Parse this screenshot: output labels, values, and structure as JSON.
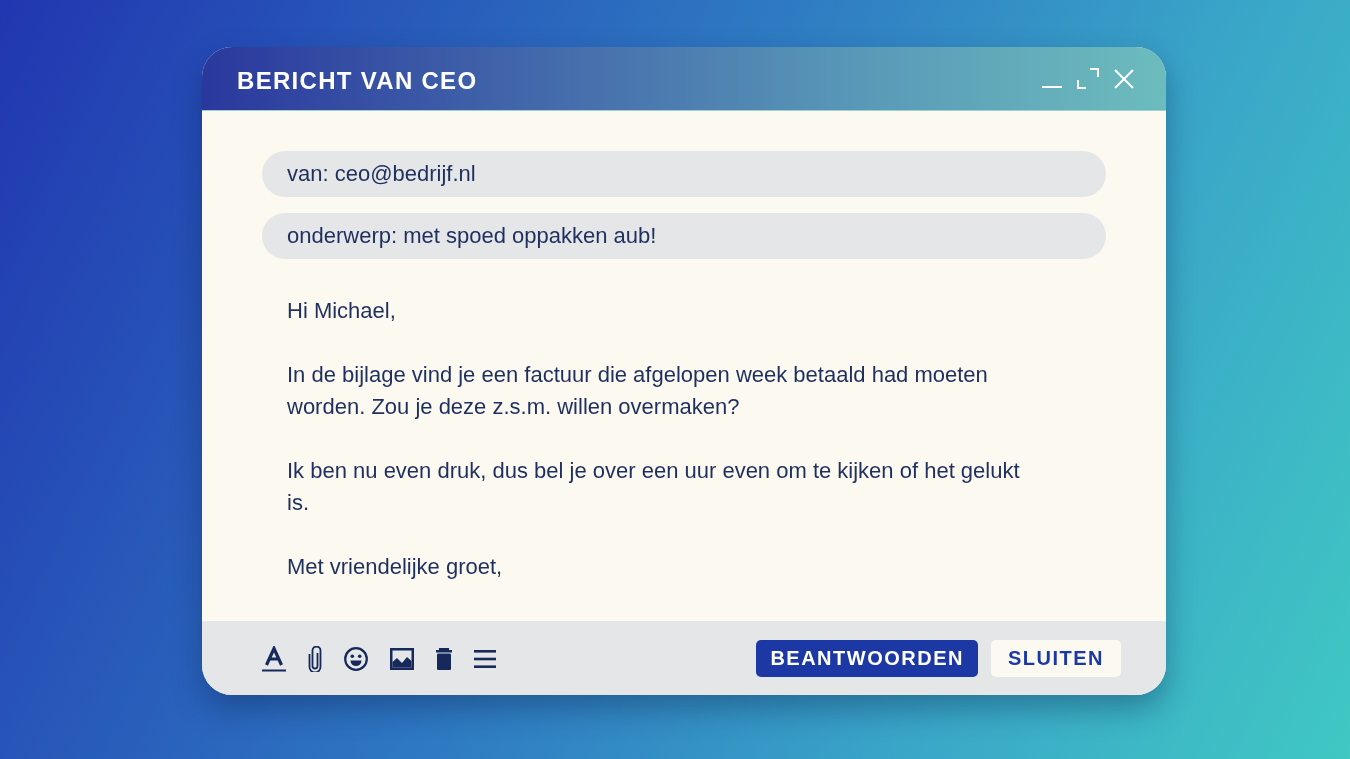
{
  "window": {
    "title": "BERICHT VAN CEO"
  },
  "fields": [
    {
      "value": "van: ceo@bedrijf.nl"
    },
    {
      "value": "onderwerp: met spoed oppakken aub!"
    }
  ],
  "message": {
    "paragraphs": [
      "Hi Michael,",
      "In de bijlage vind je een factuur die afgelopen week betaald had moeten worden. Zou je deze z.s.m. willen overmaken?",
      "Ik ben nu even druk, dus bel je over een uur even om te kijken of het gelukt is.",
      "Met vriendelijke groet,"
    ]
  },
  "buttons": [
    {
      "label": "BEANTWOORDEN",
      "kind": "primary"
    },
    {
      "label": "SLUITEN",
      "kind": "secondary"
    }
  ]
}
